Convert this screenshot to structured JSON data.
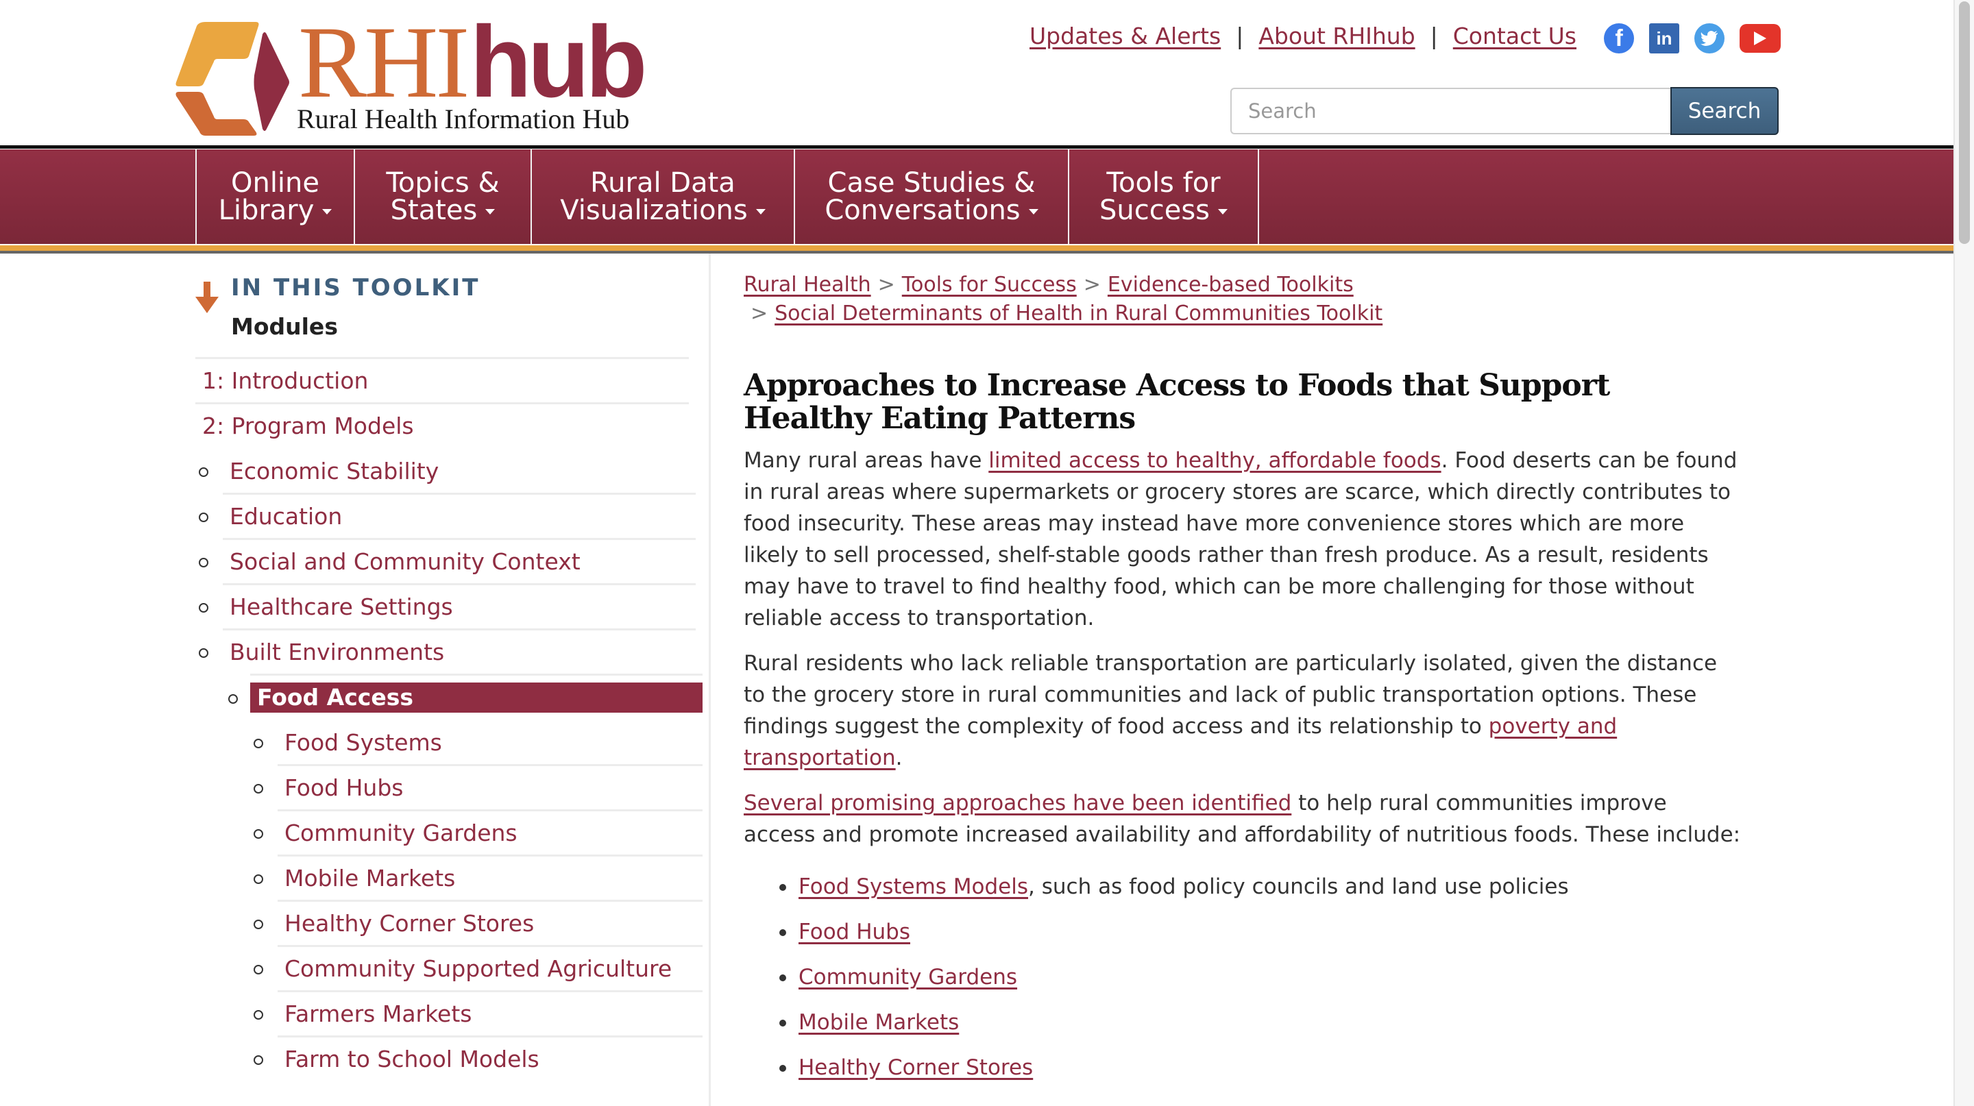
{
  "header": {
    "logo": {
      "rhi": "RHI",
      "hub": "hub",
      "subtitle": "Rural Health Information Hub"
    },
    "top_links": [
      {
        "label": "Updates & Alerts"
      },
      {
        "label": "About RHIhub"
      },
      {
        "label": "Contact Us"
      }
    ],
    "separator": "|",
    "social": [
      {
        "name": "facebook-icon",
        "glyph": "f",
        "color": "#3b7be8"
      },
      {
        "name": "linkedin-icon",
        "glyph": "in",
        "color": "#3567b0"
      },
      {
        "name": "twitter-icon",
        "glyph": "🐦",
        "color": "#4a9fe8"
      },
      {
        "name": "youtube-icon",
        "glyph": "▶",
        "color": "#e3342a"
      }
    ],
    "search": {
      "placeholder": "Search",
      "value": "",
      "button_label": "Search"
    }
  },
  "nav": {
    "items": [
      {
        "line1": "Online",
        "line2": "Library"
      },
      {
        "line1": "Topics &",
        "line2": "States"
      },
      {
        "line1": "Rural Data",
        "line2": "Visualizations"
      },
      {
        "line1": "Case Studies &",
        "line2": "Conversations"
      },
      {
        "line1": "Tools for",
        "line2": "Success"
      }
    ]
  },
  "sidebar": {
    "heading": "IN THIS TOOLKIT",
    "modules_label": "Modules",
    "items": [
      {
        "label": "1: Introduction",
        "level": 0
      },
      {
        "label": "2: Program Models",
        "level": 0
      },
      {
        "label": "Economic Stability",
        "level": 1
      },
      {
        "label": "Education",
        "level": 1
      },
      {
        "label": "Social and Community Context",
        "level": 1
      },
      {
        "label": "Healthcare Settings",
        "level": 1
      },
      {
        "label": "Built Environments",
        "level": 1
      },
      {
        "label": "Food Access",
        "level": 2,
        "active": true
      },
      {
        "label": "Food Systems",
        "level": 3
      },
      {
        "label": "Food Hubs",
        "level": 3
      },
      {
        "label": "Community Gardens",
        "level": 3
      },
      {
        "label": "Mobile Markets",
        "level": 3
      },
      {
        "label": "Healthy Corner Stores",
        "level": 3
      },
      {
        "label": "Community Supported Agriculture",
        "level": 3
      },
      {
        "label": "Farmers Markets",
        "level": 3
      },
      {
        "label": "Farm to School Models",
        "level": 3
      }
    ]
  },
  "content": {
    "breadcrumb": [
      {
        "label": "Rural Health"
      },
      {
        "label": "Tools for Success"
      },
      {
        "label": "Evidence-based Toolkits"
      },
      {
        "label": "Social Determinants of Health in Rural Communities Toolkit"
      }
    ],
    "breadcrumb_sep": ">",
    "title": "Approaches to Increase Access to Foods that Support Healthy Eating Patterns",
    "p1": {
      "before": "Many rural areas have ",
      "link": "limited access to healthy, affordable foods",
      "after": ". Food deserts can be found in rural areas where supermarkets or grocery stores are scarce, which directly contributes to food insecurity. These areas may instead have more convenience stores which are more likely to sell processed, shelf-stable goods rather than fresh produce. As a result, residents may have to travel to find healthy food, which can be more challenging for those without reliable access to transportation."
    },
    "p2": {
      "before": "Rural residents who lack reliable transportation are particularly isolated, given the distance to the grocery store in rural communities and lack of public transportation options. These findings suggest the complexity of food access and its relationship to ",
      "link": "poverty and transportation",
      "after": "."
    },
    "p3": {
      "link": "Several promising approaches have been identified",
      "after": " to help rural communities improve access and promote increased availability and affordability of nutritious foods. These include:"
    },
    "bullets": [
      {
        "link": "Food Systems Models",
        "after": ", such as food policy councils and land use policies"
      },
      {
        "link": "Food Hubs",
        "after": ""
      },
      {
        "link": "Community Gardens",
        "after": ""
      },
      {
        "link": "Mobile Markets",
        "after": ""
      },
      {
        "link": "Healthy Corner Stores",
        "after": ""
      }
    ]
  },
  "colors": {
    "brand_maroon": "#8f2d42",
    "brand_orange": "#cf6a35",
    "accent_gold": "#e8a43f",
    "heading_blue": "#3f5f7c",
    "search_button": "#466987"
  }
}
